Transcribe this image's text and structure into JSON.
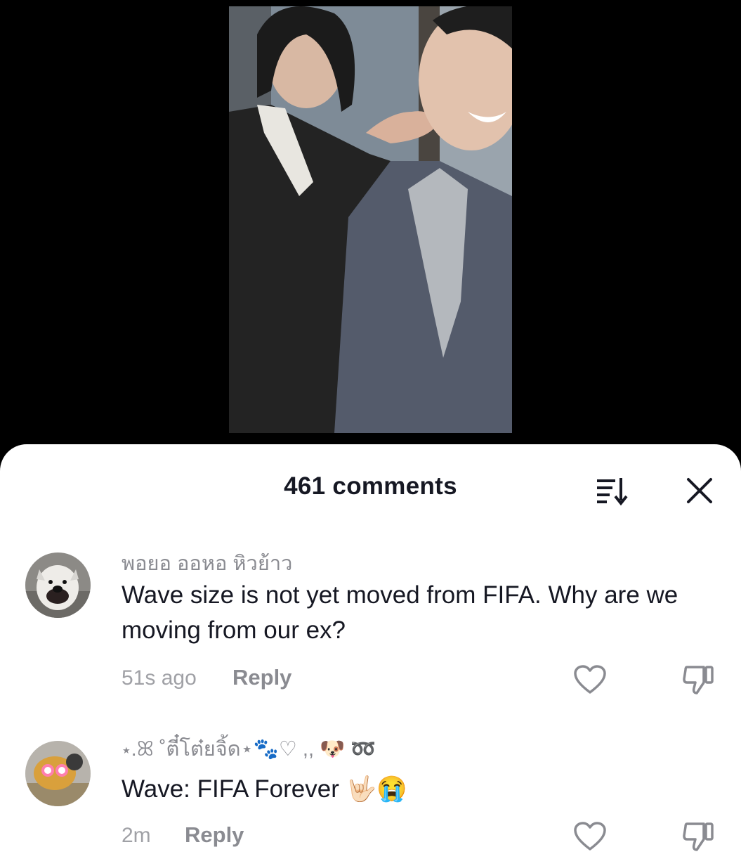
{
  "video": {
    "description_icon": "video-thumbnail"
  },
  "comments_panel": {
    "title": "461 comments",
    "sort_icon": "sort-icon",
    "close_icon": "close-icon"
  },
  "comments": [
    {
      "username": "พอยอ ออหอ หิวย้าว",
      "text": "Wave size is not yet moved from FIFA. Why are we moving from our ex?",
      "time": "51s ago",
      "reply_label": "Reply"
    },
    {
      "username": "⋆.ꕤ ˚ตี๋โต๋ยจิ้ด⋆🐾♡ ,, 🐶 ➿",
      "text": "Wave: FIFA Forever 🤟🏻😭",
      "time": "2m",
      "reply_label": "Reply"
    }
  ]
}
